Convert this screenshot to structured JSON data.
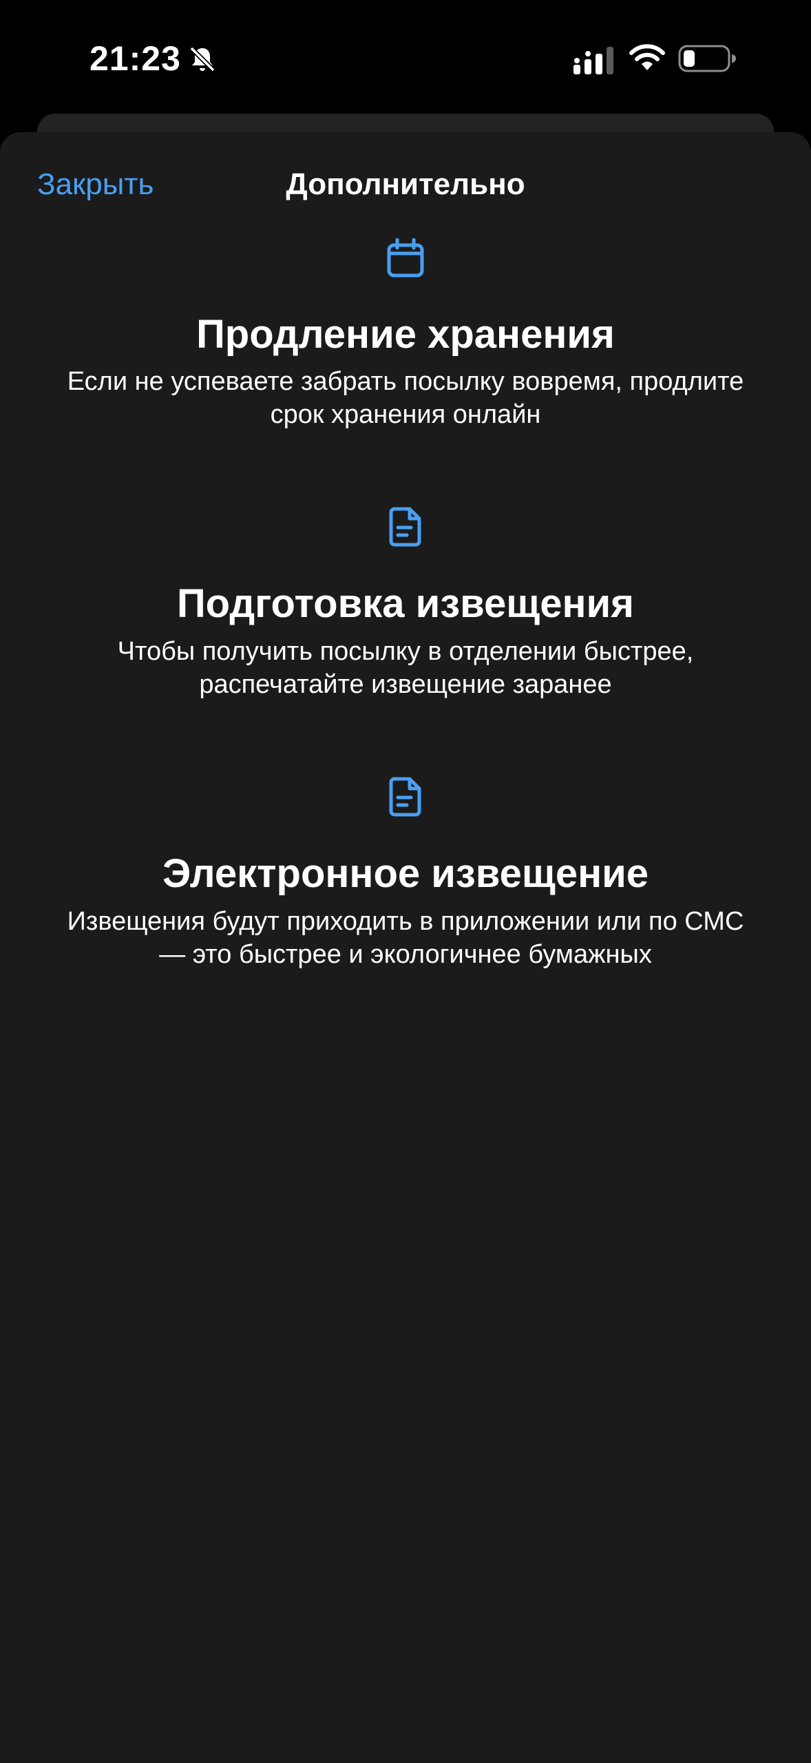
{
  "status_bar": {
    "time": "21:23",
    "icons": [
      "bell-muted-icon",
      "signal-icon",
      "wifi-icon",
      "battery-icon"
    ]
  },
  "nav": {
    "close_label": "Закрыть",
    "title": "Дополнительно"
  },
  "features": [
    {
      "icon": "calendar-icon",
      "title": "Продление хранения",
      "description_line1": "Если не успеваете забрать посылку вовремя, продлите",
      "description_line2": "срок хранения онлайн"
    },
    {
      "icon": "document-icon",
      "title": "Подготовка извещения",
      "description_line1": "Чтобы получить посылку в отделении быстрее,",
      "description_line2": "распечатайте извещение заранее"
    },
    {
      "icon": "document-icon",
      "title": "Электронное извещение",
      "description_line1": "Извещения будут приходить в приложении или по СМС",
      "description_line2": "— это быстрее и экологичнее бумажных"
    }
  ],
  "colors": {
    "accent": "#4a9ff0",
    "sheet_background": "#1b1b1c",
    "screen_background": "#000000",
    "text": "#ffffff"
  }
}
